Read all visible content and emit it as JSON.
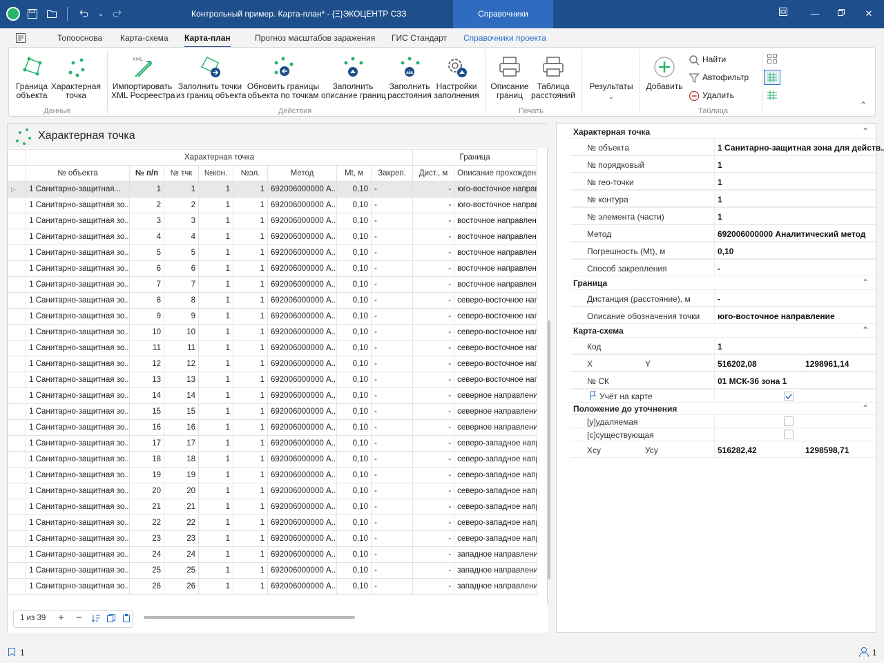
{
  "titlebar": {
    "document_title": "Контрольный пример. Карта-план* - {Ξ}ЭКОЦЕНТР СЗЗ",
    "context_tab": "Справочники",
    "undo_icon": "undo-icon",
    "redo_icon": "redo-icon"
  },
  "menu": {
    "items": [
      "Топооснова",
      "Карта-схема",
      "Карта-план",
      "Прогноз масштабов заражения",
      "ГИС Стандарт",
      "Справочники проекта"
    ],
    "active": "Карта-план"
  },
  "ribbon": {
    "data_group": {
      "label": "Данные",
      "boundary": "Граница\nобъекта",
      "point": "Характерная\nточка"
    },
    "actions_group": {
      "label": "Действия",
      "import": "Импортировать\nXML Росреестра",
      "fill_points": "Заполнить точки\nиз границ объекта",
      "update_bounds": "Обновить границы\nобъекта по точкам",
      "fill_desc": "Заполнить\nописание границ",
      "fill_dist": "Заполнить\nрасстояния",
      "settings": "Настройки\nзаполнения"
    },
    "print_group": {
      "label": "Печать",
      "desc": "Описание\nграниц",
      "table": "Таблица\nрасстояний"
    },
    "results": "Результаты",
    "table_group": {
      "label": "Таблица",
      "add": "Добавить",
      "find": "Найти",
      "autofilter": "Автофильтр",
      "delete": "Удалить"
    }
  },
  "left_panel": {
    "title": "Характерная точка",
    "group_headers": {
      "point": "Характерная точка",
      "boundary": "Граница"
    },
    "columns": [
      "№ объекта",
      "№ п/п",
      "№ тчк",
      "№кон.",
      "№эл.",
      "Метод",
      "Mt, м",
      "Закреп.",
      "Дист., м",
      "Описание прохождения г"
    ],
    "rows": [
      [
        "1 Санитарно-защитная...",
        "1",
        "1",
        "1",
        "1",
        "692006000000 А...",
        "0,10",
        "-",
        "-",
        "юго-восточное направле"
      ],
      [
        "1 Санитарно-защитная зо...",
        "2",
        "2",
        "1",
        "1",
        "692006000000 А...",
        "0,10",
        "-",
        "-",
        "юго-восточное направле"
      ],
      [
        "1 Санитарно-защитная зо...",
        "3",
        "3",
        "1",
        "1",
        "692006000000 А...",
        "0,10",
        "-",
        "-",
        "восточное направление"
      ],
      [
        "1 Санитарно-защитная зо...",
        "4",
        "4",
        "1",
        "1",
        "692006000000 А...",
        "0,10",
        "-",
        "-",
        "восточное направление"
      ],
      [
        "1 Санитарно-защитная зо...",
        "5",
        "5",
        "1",
        "1",
        "692006000000 А...",
        "0,10",
        "-",
        "-",
        "восточное направление"
      ],
      [
        "1 Санитарно-защитная зо...",
        "6",
        "6",
        "1",
        "1",
        "692006000000 А...",
        "0,10",
        "-",
        "-",
        "восточное направление"
      ],
      [
        "1 Санитарно-защитная зо...",
        "7",
        "7",
        "1",
        "1",
        "692006000000 А...",
        "0,10",
        "-",
        "-",
        "восточное направление"
      ],
      [
        "1 Санитарно-защитная зо...",
        "8",
        "8",
        "1",
        "1",
        "692006000000 А...",
        "0,10",
        "-",
        "-",
        "северо-восточное напр"
      ],
      [
        "1 Санитарно-защитная зо...",
        "9",
        "9",
        "1",
        "1",
        "692006000000 А...",
        "0,10",
        "-",
        "-",
        "северо-восточное напр"
      ],
      [
        "1 Санитарно-защитная зо...",
        "10",
        "10",
        "1",
        "1",
        "692006000000 А...",
        "0,10",
        "-",
        "-",
        "северо-восточное напр"
      ],
      [
        "1 Санитарно-защитная зо...",
        "11",
        "11",
        "1",
        "1",
        "692006000000 А...",
        "0,10",
        "-",
        "-",
        "северо-восточное напр"
      ],
      [
        "1 Санитарно-защитная зо...",
        "12",
        "12",
        "1",
        "1",
        "692006000000 А...",
        "0,10",
        "-",
        "-",
        "северо-восточное напр"
      ],
      [
        "1 Санитарно-защитная зо...",
        "13",
        "13",
        "1",
        "1",
        "692006000000 А...",
        "0,10",
        "-",
        "-",
        "северо-восточное напр"
      ],
      [
        "1 Санитарно-защитная зо...",
        "14",
        "14",
        "1",
        "1",
        "692006000000 А...",
        "0,10",
        "-",
        "-",
        "северное направление"
      ],
      [
        "1 Санитарно-защитная зо...",
        "15",
        "15",
        "1",
        "1",
        "692006000000 А...",
        "0,10",
        "-",
        "-",
        "северное направление"
      ],
      [
        "1 Санитарно-защитная зо...",
        "16",
        "16",
        "1",
        "1",
        "692006000000 А...",
        "0,10",
        "-",
        "-",
        "северное направление"
      ],
      [
        "1 Санитарно-защитная зо...",
        "17",
        "17",
        "1",
        "1",
        "692006000000 А...",
        "0,10",
        "-",
        "-",
        "северо-западное напр"
      ],
      [
        "1 Санитарно-защитная зо...",
        "18",
        "18",
        "1",
        "1",
        "692006000000 А...",
        "0,10",
        "-",
        "-",
        "северо-западное напр"
      ],
      [
        "1 Санитарно-защитная зо...",
        "19",
        "19",
        "1",
        "1",
        "692006000000 А...",
        "0,10",
        "-",
        "-",
        "северо-западное напр"
      ],
      [
        "1 Санитарно-защитная зо...",
        "20",
        "20",
        "1",
        "1",
        "692006000000 А...",
        "0,10",
        "-",
        "-",
        "северо-западное напр"
      ],
      [
        "1 Санитарно-защитная зо...",
        "21",
        "21",
        "1",
        "1",
        "692006000000 А...",
        "0,10",
        "-",
        "-",
        "северо-западное напр"
      ],
      [
        "1 Санитарно-защитная зо...",
        "22",
        "22",
        "1",
        "1",
        "692006000000 А...",
        "0,10",
        "-",
        "-",
        "северо-западное напр"
      ],
      [
        "1 Санитарно-защитная зо...",
        "23",
        "23",
        "1",
        "1",
        "692006000000 А...",
        "0,10",
        "-",
        "-",
        "северо-западное напр"
      ],
      [
        "1 Санитарно-защитная зо...",
        "24",
        "24",
        "1",
        "1",
        "692006000000 А...",
        "0,10",
        "-",
        "-",
        "западное направление"
      ],
      [
        "1 Санитарно-защитная зо...",
        "25",
        "25",
        "1",
        "1",
        "692006000000 А...",
        "0,10",
        "-",
        "-",
        "западное направление"
      ],
      [
        "1 Санитарно-защитная зо...",
        "26",
        "26",
        "1",
        "1",
        "692006000000 А...",
        "0,10",
        "-",
        "-",
        "западное направление"
      ]
    ],
    "pager": "1 из 39"
  },
  "right_panel": {
    "sections": {
      "point": "Характерная точка",
      "boundary": "Граница",
      "map_scheme": "Карта-схема",
      "prior": "Положение до уточнения"
    },
    "point_props": [
      {
        "label": "№ объекта",
        "value": "1 Санитарно-защитная зона для действ..."
      },
      {
        "label": "№ порядковый",
        "value": "1"
      },
      {
        "label": "№ гео-точки",
        "value": "1"
      },
      {
        "label": "№ контура",
        "value": "1"
      },
      {
        "label": "№ элемента (части)",
        "value": "1"
      },
      {
        "label": "Метод",
        "value": "692006000000 Аналитический метод"
      },
      {
        "label": "Погрешность (Mt), м",
        "value": "0,10"
      },
      {
        "label": "Способ закрепления",
        "value": "-"
      }
    ],
    "boundary_props": [
      {
        "label": "Дистанция (расстояние), м",
        "value": "-"
      },
      {
        "label": "Описание обозначения точки",
        "value": "юго-восточное направление"
      }
    ],
    "map": {
      "code_label": "Код",
      "code_value": "1",
      "x_label": "X",
      "y_label": "Y",
      "x_value": "516202,08",
      "y_value": "1298961,14",
      "sk_label": "№ СК",
      "sk_value": "01 МСК-36 зона 1",
      "on_map_label": "Учёт на карте",
      "on_map_checked": true
    },
    "prior": {
      "removed_label": "[у]удаляемая",
      "removed_checked": false,
      "existing_label": "[с]существующая",
      "existing_checked": false,
      "x_label": "Хсу",
      "y_label": "Усу",
      "x_value": "516282,42",
      "y_value": "1298598,71"
    }
  },
  "status": {
    "count": "1"
  },
  "colors": {
    "titlebar": "#1e4f8c",
    "accent": "#2a6fc9",
    "ribbon_icon": "#27b36b"
  }
}
